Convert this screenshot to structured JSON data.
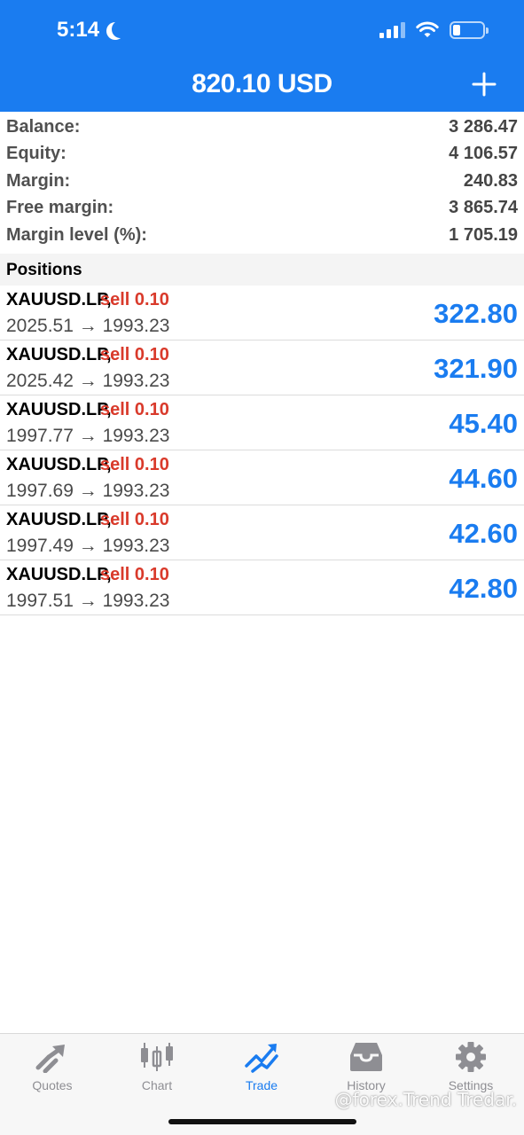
{
  "status": {
    "time": "5:14"
  },
  "header": {
    "title": "820.10 USD"
  },
  "summary": [
    {
      "label": "Balance:",
      "value": "3 286.47"
    },
    {
      "label": "Equity:",
      "value": "4 106.57"
    },
    {
      "label": "Margin:",
      "value": "240.83"
    },
    {
      "label": "Free margin:",
      "value": "3 865.74"
    },
    {
      "label": "Margin level (%):",
      "value": "1 705.19"
    }
  ],
  "positions_header": "Positions",
  "positions": [
    {
      "symbol": "XAUUSD.LP,",
      "side": "sell 0.10",
      "prices": "2025.51 → 1993.23",
      "profit": "322.80"
    },
    {
      "symbol": "XAUUSD.LP,",
      "side": "sell 0.10",
      "prices": "2025.42 → 1993.23",
      "profit": "321.90"
    },
    {
      "symbol": "XAUUSD.LP,",
      "side": "sell 0.10",
      "prices": "1997.77 → 1993.23",
      "profit": "45.40"
    },
    {
      "symbol": "XAUUSD.LP,",
      "side": "sell 0.10",
      "prices": "1997.69 → 1993.23",
      "profit": "44.60"
    },
    {
      "symbol": "XAUUSD.LP,",
      "side": "sell 0.10",
      "prices": "1997.49 → 1993.23",
      "profit": "42.60"
    },
    {
      "symbol": "XAUUSD.LP,",
      "side": "sell 0.10",
      "prices": "1997.51 → 1993.23",
      "profit": "42.80"
    }
  ],
  "tabs": [
    {
      "label": "Quotes",
      "icon": "quotes-icon"
    },
    {
      "label": "Chart",
      "icon": "chart-icon"
    },
    {
      "label": "Trade",
      "icon": "trade-icon",
      "active": true
    },
    {
      "label": "History",
      "icon": "history-icon"
    },
    {
      "label": "Settings",
      "icon": "gear-icon"
    }
  ],
  "watermark": "@forex.Trend Tredar.",
  "colors": {
    "accent": "#1a7cf0",
    "sell": "#d93a2b",
    "profit": "#1a7cf0"
  }
}
